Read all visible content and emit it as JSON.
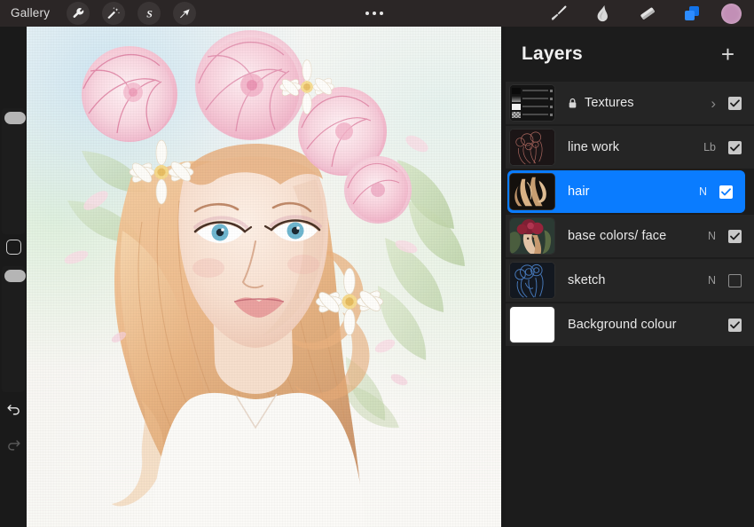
{
  "app": {
    "name": "Procreate",
    "accent_color": "#0a7cff",
    "panel_bg": "#1c1c1c",
    "topbar_bg": "#2b2626"
  },
  "topbar": {
    "gallery_label": "Gallery",
    "tools": [
      {
        "name": "actions-wrench",
        "label": "Actions"
      },
      {
        "name": "adjustments-wand",
        "label": "Adjustments"
      },
      {
        "name": "selection-s",
        "label": "Selection"
      },
      {
        "name": "transform-arrow",
        "label": "Transform"
      }
    ],
    "overflow_label": "•••",
    "right_tools": [
      {
        "name": "paint-brush",
        "label": "Paint",
        "active": false
      },
      {
        "name": "smudge",
        "label": "Smudge",
        "active": false
      },
      {
        "name": "eraser",
        "label": "Erase",
        "active": false
      },
      {
        "name": "layers",
        "label": "Layers",
        "active": true
      }
    ],
    "color_swatch": {
      "label": "Color",
      "hex": "#c28fb6"
    }
  },
  "sidebar": {
    "brush_size": {
      "label": "Brush size",
      "value_pct": 26
    },
    "modify_button": {
      "label": "Modify"
    },
    "opacity": {
      "label": "Opacity",
      "value_pct": 12
    },
    "undo": {
      "label": "Undo",
      "enabled": true
    },
    "redo": {
      "label": "Redo",
      "enabled": false
    }
  },
  "layers_panel": {
    "title": "Layers",
    "add_label": "+",
    "layers": [
      {
        "name": "Textures",
        "type": "group",
        "locked": true,
        "blend": "",
        "visible": true,
        "chevron": "›",
        "thumb": "nested-group-stack"
      },
      {
        "name": "line work",
        "type": "layer",
        "locked": false,
        "blend": "Lb",
        "visible": true,
        "thumb": "line-work-sketch"
      },
      {
        "name": "hair",
        "type": "layer",
        "locked": false,
        "blend": "N",
        "visible": true,
        "selected": true,
        "thumb": "hair-strands"
      },
      {
        "name": "base colors/ face",
        "type": "layer",
        "locked": false,
        "blend": "N",
        "visible": true,
        "thumb": "base-colors-portrait"
      },
      {
        "name": "sketch",
        "type": "layer",
        "locked": false,
        "blend": "N",
        "visible": false,
        "thumb": "blue-sketch"
      },
      {
        "name": "Background colour",
        "type": "background",
        "locked": false,
        "blend": "",
        "visible": true,
        "thumb": "white-fill"
      }
    ]
  },
  "canvas": {
    "artwork_title": "Watercolor portrait of a woman with pink flower crown",
    "background": "#f2f0ec"
  }
}
